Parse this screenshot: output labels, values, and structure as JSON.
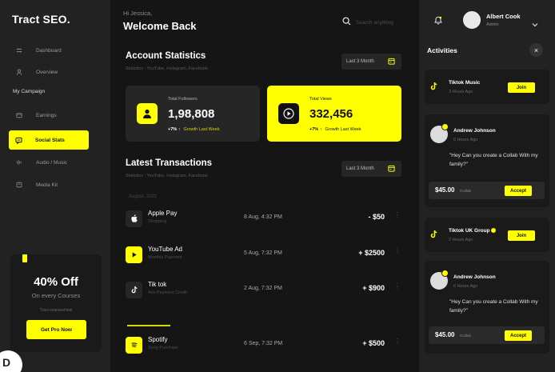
{
  "sidebar": {
    "brand": "Tract SEO.",
    "nav": [
      {
        "label": "Dashboard",
        "icon": "grid-icon"
      },
      {
        "label": "Overview",
        "icon": "user-icon"
      }
    ],
    "section_label": "My Campaign",
    "campaign": [
      {
        "label": "Earnings",
        "icon": "wallet-icon"
      },
      {
        "label": "Social Stats",
        "icon": "chat-icon",
        "active": true
      },
      {
        "label": "Audio / Music",
        "icon": "music-icon"
      },
      {
        "label": "Media Kit",
        "icon": "folder-icon"
      }
    ],
    "promo": {
      "headline": "40% Off",
      "subtitle": "On every Courses",
      "site": "Tract.courses/new",
      "cta": "Get Pro Now"
    }
  },
  "header": {
    "greeting": "Hi Jessica,",
    "title": "Welcome Back",
    "search_placeholder": "Search anything"
  },
  "account_statistics": {
    "title": "Account Statistics",
    "caption": "Statistics : YouTube, Instagram, Facebook",
    "period": "Last 3 Month",
    "followers": {
      "label": "Total Followers",
      "value": "1,98,808",
      "change": "+7% ↑",
      "note": "Growth Last Week"
    },
    "views": {
      "label": "Total Views",
      "value": "332,456",
      "change": "+7% ↑",
      "note": "Growth Last Week"
    }
  },
  "transactions": {
    "title": "Latest Transactions",
    "caption": "Statistics : YouTube, Instagram, Facebook",
    "period": "Last 3 Month",
    "month_label": "August, 2021",
    "rows": [
      {
        "name": "Apple Pay",
        "category": "Shopping",
        "date": "8 Aug, 4:32 PM",
        "amount": "- $50",
        "icon": "apple-icon"
      },
      {
        "name": "YouTube Ad",
        "category": "Monthly Payment",
        "date": "5 Aug, 7:32 PM",
        "amount": "+ $2500",
        "icon": "youtube-icon"
      },
      {
        "name": "Tik tok",
        "category": "Ads Payment Credit",
        "date": "2 Aug, 7:32 PM",
        "amount": "+ $900",
        "icon": "tiktok-icon"
      },
      {
        "name": "Spotify",
        "category": "Song Purchase",
        "date": "6 Sep, 7:32 PM",
        "amount": "+ $500",
        "icon": "spotify-icon"
      }
    ]
  },
  "user": {
    "name": "Albert Cook",
    "role": "Admin"
  },
  "activities": {
    "title": "Activities",
    "items": [
      {
        "type": "join",
        "name": "Tiktok Music",
        "time": "3 Hours Ago",
        "button": "Join"
      },
      {
        "type": "offer",
        "name": "Andrew Johnson",
        "time": "6 Hours Ago",
        "message": "\"Hey Can you create a Collab With my family?\"",
        "amount": "$45.00",
        "unit": "/Collab",
        "button": "Accept"
      },
      {
        "type": "join",
        "name": "Tiktok UK Group",
        "time": "2 Hours Ago",
        "button": "Join"
      },
      {
        "type": "offer",
        "name": "Andrew Johnson",
        "time": "6 Hours Ago",
        "message": "\"Hey Can you create a Collab With my family?\"",
        "amount": "$45.00",
        "unit": "/Collab",
        "button": "Accept"
      }
    ]
  },
  "colors": {
    "accent": "#ffff00",
    "background": "#151515",
    "panel": "#222222"
  }
}
